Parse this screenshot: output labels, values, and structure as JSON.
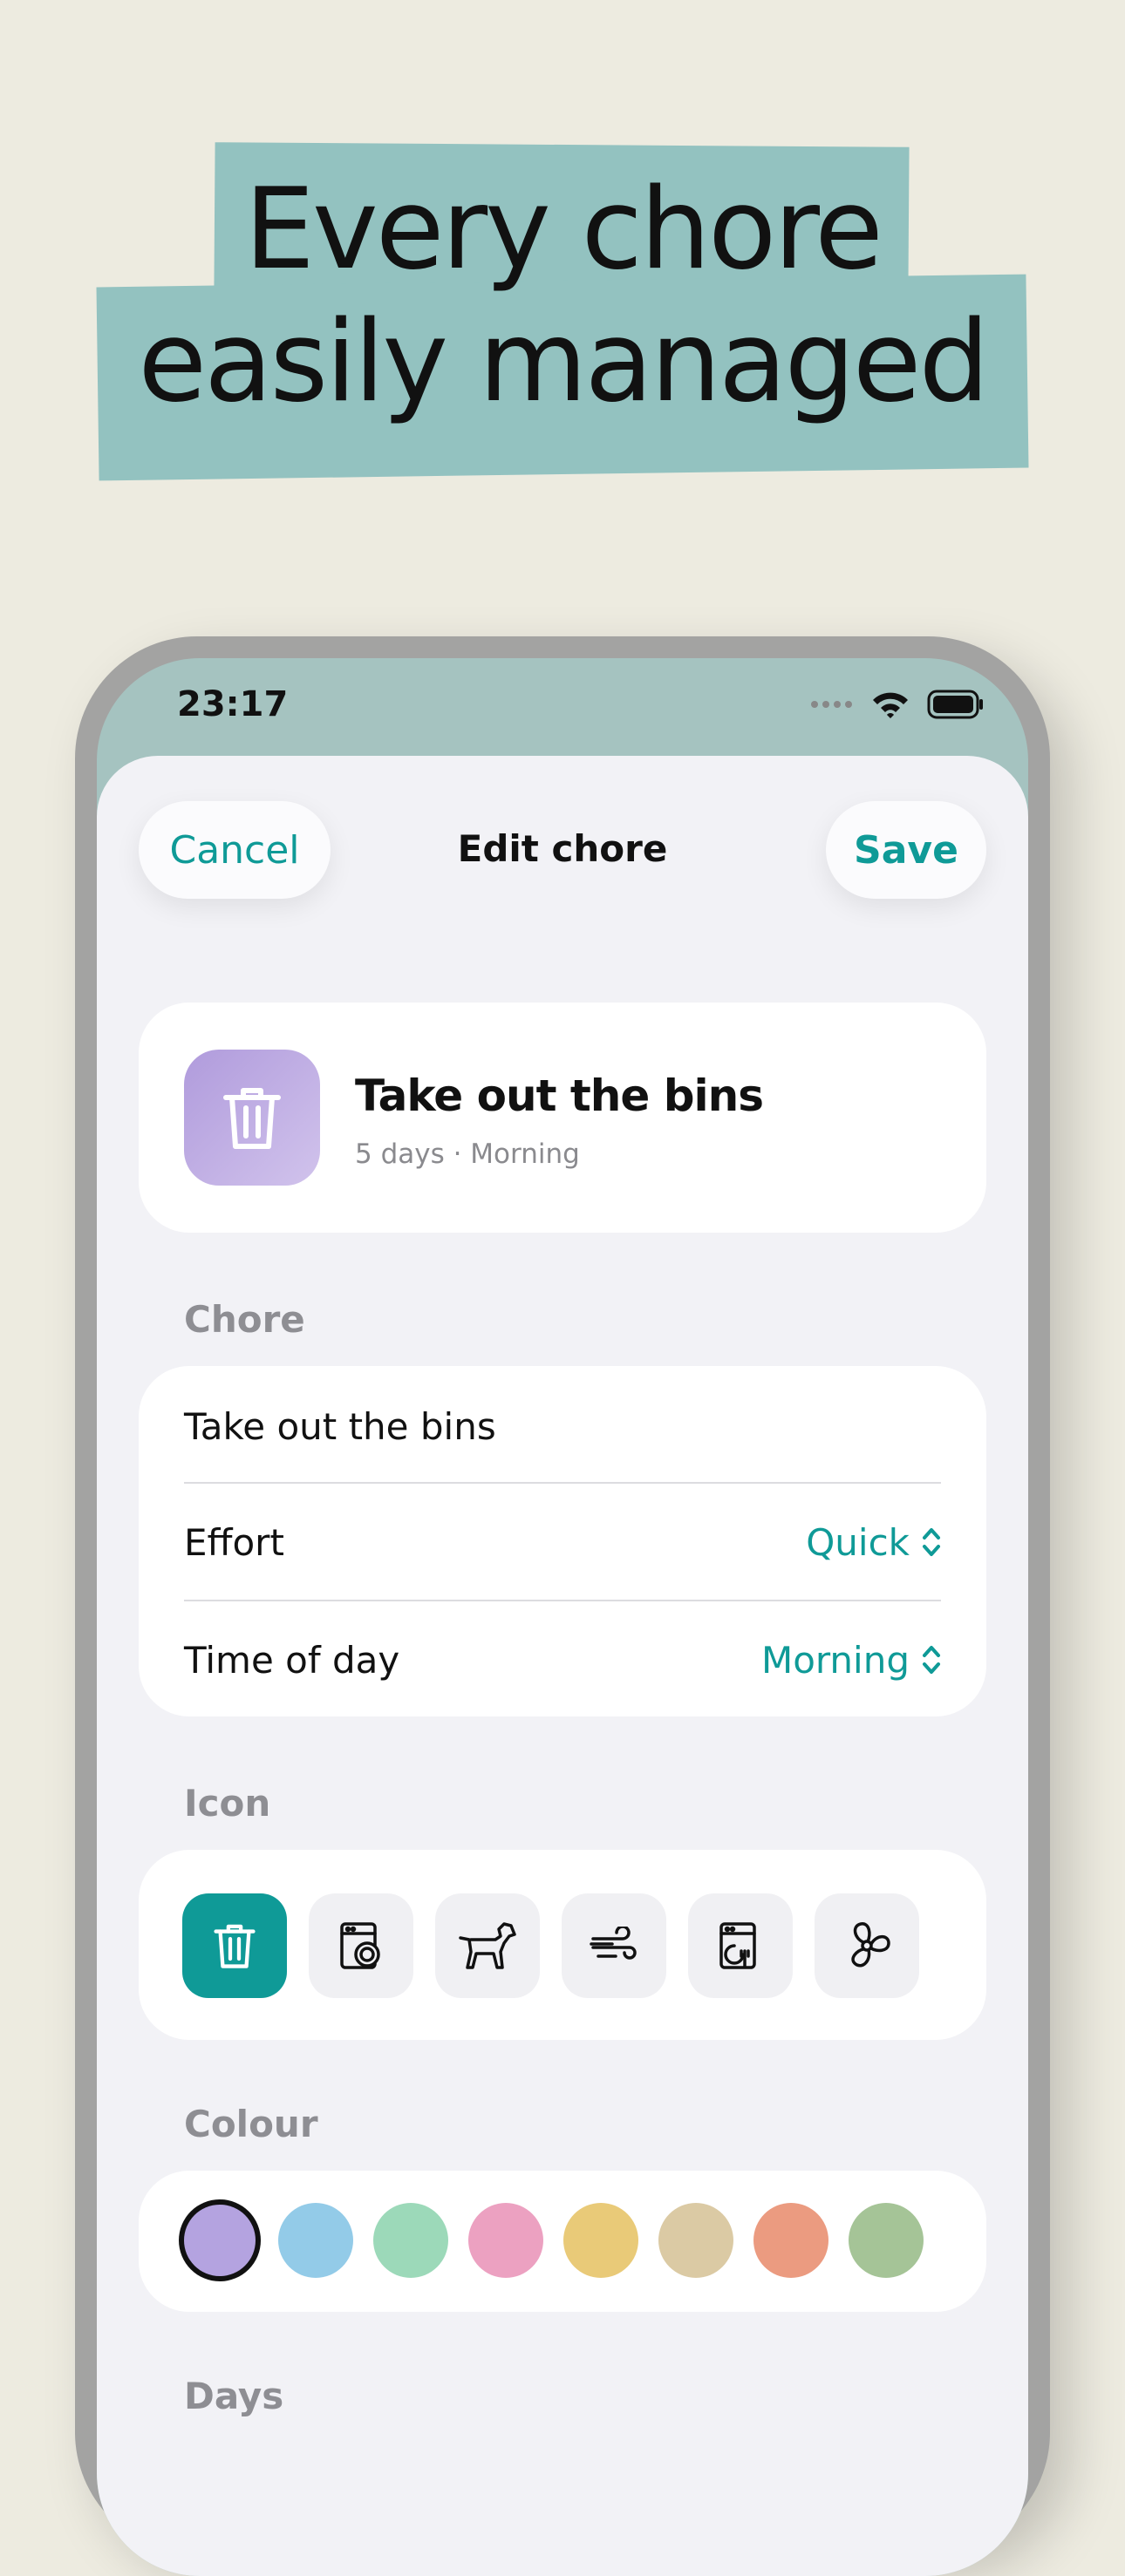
{
  "headline": {
    "line1": "Every chore",
    "line2": "easily managed"
  },
  "status_bar": {
    "time": "23:17"
  },
  "nav": {
    "cancel_label": "Cancel",
    "title": "Edit chore",
    "save_label": "Save"
  },
  "summary": {
    "icon": "trash-icon",
    "name": "Take out the bins",
    "subtitle": "5 days · Morning"
  },
  "chore_section": {
    "label": "Chore",
    "name_value": "Take out the bins",
    "effort": {
      "label": "Effort",
      "value": "Quick"
    },
    "time_of_day": {
      "label": "Time of day",
      "value": "Morning"
    }
  },
  "icon_section": {
    "label": "Icon",
    "icons": [
      "trash-icon",
      "washing-machine-icon",
      "dog-icon",
      "wind-icon",
      "dishwasher-icon",
      "fan-icon"
    ],
    "selected_index": 0
  },
  "colour_section": {
    "label": "Colour",
    "colours": [
      "#b4a3e0",
      "#93cbe8",
      "#9cd9b9",
      "#eca1c1",
      "#e9ca78",
      "#dbcaa4",
      "#eb9b80",
      "#a5c497"
    ],
    "selected_index": 0
  },
  "days_section": {
    "label": "Days"
  },
  "colors": {
    "accent": "#0f9a97",
    "band": "#93c2c0",
    "background": "#edebe0"
  }
}
